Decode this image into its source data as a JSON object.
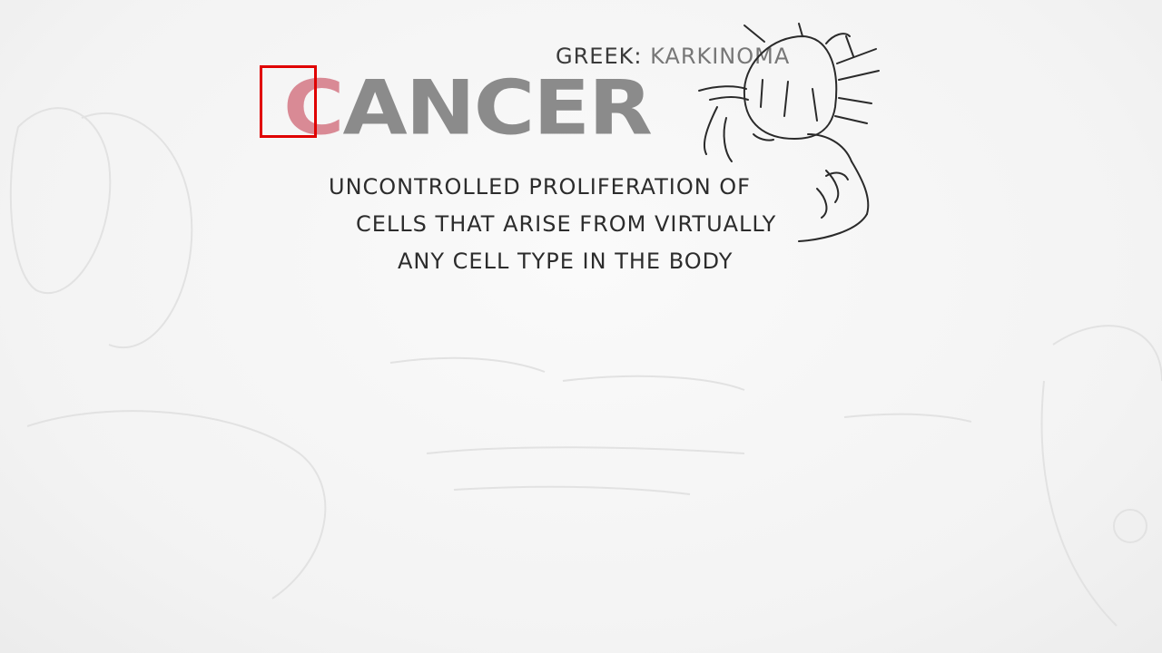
{
  "title": {
    "first_letter": "C",
    "rest": "ANCER"
  },
  "greek": {
    "label": "GREEK:",
    "word": "KARKINOMA"
  },
  "definition": {
    "lines": [
      "UNCONTROLLED PROLIFERATION OF",
      "CELLS THAT ARISE FROM VIRTUALLY",
      "ANY CELL TYPE IN THE BODY"
    ]
  },
  "illustration": {
    "icon": "crab-drawing-icon"
  },
  "highlight": {
    "color": "#e00000"
  },
  "colors": {
    "background": "#f4f4f4",
    "title": "#8b8b8b",
    "title_accent": "#d98a95",
    "ink": "#2c2c2c"
  }
}
